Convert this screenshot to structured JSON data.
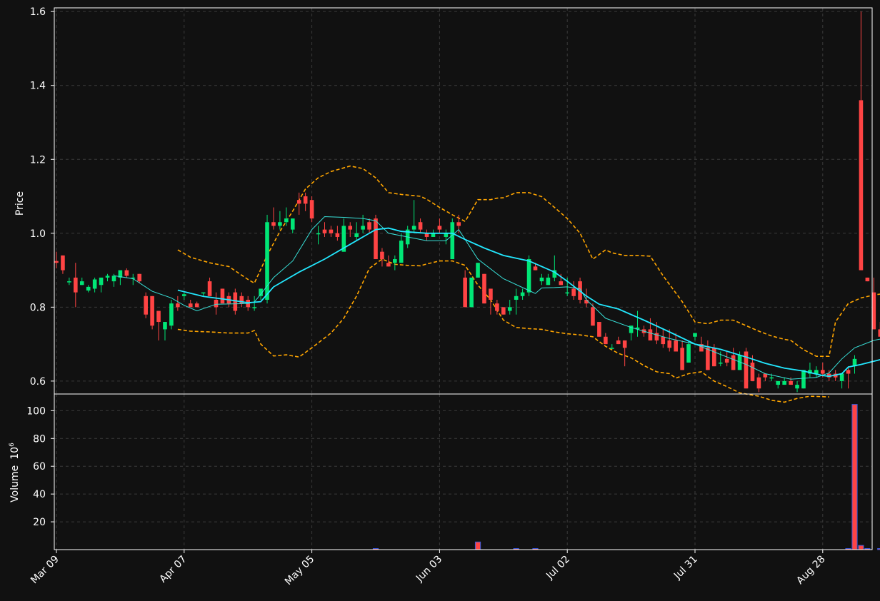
{
  "colors": {
    "background": "#111111",
    "up": "#00e676",
    "down": "#ff4444",
    "ma_fast": "#38e0d8",
    "ma_slow": "#22e8ff",
    "bollinger": "#ffa500",
    "grid": "#3a3a3a",
    "volume_edge": "#3b5bdb"
  },
  "chart_data": {
    "type": "candlestick",
    "title": "",
    "ylabel": "Price",
    "volume_ylabel": "Volume",
    "volume_unit_base": "10",
    "volume_unit_exp": "6",
    "grid": true,
    "price_ylim": [
      0.565,
      1.61
    ],
    "volume_ylim": [
      0,
      112
    ],
    "price_yticks": [
      "0.6",
      "0.8",
      "1.0",
      "1.2",
      "1.4",
      "1.6"
    ],
    "volume_yticks": [
      "20",
      "40",
      "60",
      "80",
      "100"
    ],
    "x_tick_labels": [
      {
        "index": 0,
        "label": "Mar 09"
      },
      {
        "index": 20,
        "label": "Apr 07"
      },
      {
        "index": 40,
        "label": "May 05"
      },
      {
        "index": 60,
        "label": "Jun 03"
      },
      {
        "index": 80,
        "label": "Jul 02"
      },
      {
        "index": 100,
        "label": "Jul 31"
      },
      {
        "index": 120,
        "label": "Aug 28"
      }
    ],
    "candles": [
      [
        0.925,
        0.95,
        0.905,
        0.92
      ],
      [
        0.94,
        0.94,
        0.89,
        0.9
      ],
      [
        0.87,
        0.88,
        0.86,
        0.87
      ],
      [
        0.88,
        0.92,
        0.8,
        0.84
      ],
      [
        0.86,
        0.88,
        0.86,
        0.87
      ],
      [
        0.845,
        0.86,
        0.84,
        0.855
      ],
      [
        0.85,
        0.88,
        0.84,
        0.875
      ],
      [
        0.86,
        0.88,
        0.84,
        0.88
      ],
      [
        0.88,
        0.89,
        0.87,
        0.885
      ],
      [
        0.87,
        0.89,
        0.855,
        0.885
      ],
      [
        0.88,
        0.89,
        0.86,
        0.9
      ],
      [
        0.9,
        0.905,
        0.88,
        0.885
      ],
      [
        0.88,
        0.89,
        0.86,
        0.88
      ],
      [
        0.89,
        0.89,
        0.865,
        0.87
      ],
      [
        0.83,
        0.84,
        0.77,
        0.78
      ],
      [
        0.83,
        0.83,
        0.74,
        0.75
      ],
      [
        0.79,
        0.79,
        0.71,
        0.76
      ],
      [
        0.74,
        0.76,
        0.71,
        0.76
      ],
      [
        0.75,
        0.82,
        0.74,
        0.81
      ],
      [
        0.81,
        0.83,
        0.79,
        0.8
      ],
      [
        0.83,
        0.84,
        0.82,
        0.835
      ],
      [
        0.81,
        0.82,
        0.8,
        0.8
      ],
      [
        0.81,
        0.815,
        0.8,
        0.8
      ],
      [
        0.84,
        0.84,
        0.83,
        0.84
      ],
      [
        0.87,
        0.88,
        0.83,
        0.83
      ],
      [
        0.82,
        0.84,
        0.78,
        0.8
      ],
      [
        0.85,
        0.85,
        0.82,
        0.81
      ],
      [
        0.83,
        0.84,
        0.8,
        0.81
      ],
      [
        0.84,
        0.85,
        0.78,
        0.79
      ],
      [
        0.83,
        0.84,
        0.8,
        0.81
      ],
      [
        0.82,
        0.83,
        0.79,
        0.8
      ],
      [
        0.8,
        0.83,
        0.79,
        0.8
      ],
      [
        0.83,
        0.85,
        0.82,
        0.85
      ],
      [
        0.82,
        1.05,
        0.81,
        1.03
      ],
      [
        1.03,
        1.07,
        1.01,
        1.02
      ],
      [
        1.02,
        1.06,
        1.01,
        1.03
      ],
      [
        1.03,
        1.07,
        1.02,
        1.04
      ],
      [
        1.01,
        1.04,
        1.0,
        1.04
      ],
      [
        1.09,
        1.11,
        1.05,
        1.08
      ],
      [
        1.1,
        1.11,
        1.06,
        1.08
      ],
      [
        1.09,
        1.1,
        1.03,
        1.04
      ],
      [
        1.0,
        1.02,
        0.97,
        1.0
      ],
      [
        1.01,
        1.03,
        0.99,
        1.0
      ],
      [
        1.01,
        1.02,
        0.99,
        1.0
      ],
      [
        1.0,
        1.02,
        0.98,
        0.99
      ],
      [
        0.95,
        1.04,
        0.95,
        1.02
      ],
      [
        1.02,
        1.03,
        0.99,
        1.01
      ],
      [
        0.99,
        1.03,
        0.98,
        1.0
      ],
      [
        1.01,
        1.05,
        1.0,
        1.02
      ],
      [
        1.03,
        1.04,
        1.0,
        1.01
      ],
      [
        1.04,
        1.05,
        0.93,
        0.93
      ],
      [
        0.95,
        0.96,
        0.91,
        0.93
      ],
      [
        0.92,
        0.94,
        0.91,
        0.91
      ],
      [
        0.92,
        0.94,
        0.9,
        0.93
      ],
      [
        0.92,
        1.0,
        0.92,
        0.98
      ],
      [
        0.97,
        1.02,
        0.96,
        1.01
      ],
      [
        1.01,
        1.09,
        1.0,
        1.02
      ],
      [
        1.03,
        1.04,
        1.0,
        1.01
      ],
      [
        1.0,
        1.01,
        0.98,
        0.99
      ],
      [
        0.99,
        1.01,
        0.99,
        1.0
      ],
      [
        1.02,
        1.04,
        1.0,
        1.01
      ],
      [
        0.99,
        1.01,
        0.97,
        1.0
      ],
      [
        0.93,
        1.04,
        0.93,
        1.03
      ],
      [
        1.03,
        1.05,
        1.0,
        1.02
      ],
      [
        0.88,
        0.9,
        0.8,
        0.8
      ],
      [
        0.8,
        0.88,
        0.8,
        0.88
      ],
      [
        0.88,
        0.92,
        0.88,
        0.92
      ],
      [
        0.89,
        0.89,
        0.81,
        0.81
      ],
      [
        0.85,
        0.85,
        0.78,
        0.82
      ],
      [
        0.81,
        0.82,
        0.78,
        0.79
      ],
      [
        0.8,
        0.8,
        0.78,
        0.78
      ],
      [
        0.79,
        0.82,
        0.78,
        0.8
      ],
      [
        0.82,
        0.85,
        0.78,
        0.83
      ],
      [
        0.83,
        0.85,
        0.82,
        0.84
      ],
      [
        0.84,
        0.94,
        0.83,
        0.93
      ],
      [
        0.91,
        0.92,
        0.9,
        0.9
      ],
      [
        0.87,
        0.89,
        0.86,
        0.88
      ],
      [
        0.86,
        0.89,
        0.86,
        0.88
      ],
      [
        0.88,
        0.94,
        0.87,
        0.9
      ],
      [
        0.87,
        0.89,
        0.86,
        0.86
      ],
      [
        0.84,
        0.88,
        0.83,
        0.84
      ],
      [
        0.85,
        0.87,
        0.82,
        0.83
      ],
      [
        0.87,
        0.88,
        0.81,
        0.82
      ],
      [
        0.82,
        0.85,
        0.8,
        0.81
      ],
      [
        0.8,
        0.81,
        0.75,
        0.75
      ],
      [
        0.76,
        0.76,
        0.72,
        0.72
      ],
      [
        0.72,
        0.73,
        0.7,
        0.7
      ],
      [
        0.69,
        0.7,
        0.69,
        0.69
      ],
      [
        0.71,
        0.72,
        0.7,
        0.7
      ],
      [
        0.71,
        0.71,
        0.64,
        0.69
      ],
      [
        0.73,
        0.75,
        0.71,
        0.75
      ],
      [
        0.74,
        0.79,
        0.72,
        0.745
      ],
      [
        0.74,
        0.75,
        0.72,
        0.73
      ],
      [
        0.74,
        0.77,
        0.71,
        0.71
      ],
      [
        0.73,
        0.76,
        0.7,
        0.71
      ],
      [
        0.72,
        0.74,
        0.69,
        0.7
      ],
      [
        0.71,
        0.74,
        0.68,
        0.69
      ],
      [
        0.71,
        0.73,
        0.69,
        0.68
      ],
      [
        0.69,
        0.71,
        0.63,
        0.63
      ],
      [
        0.65,
        0.71,
        0.65,
        0.7
      ],
      [
        0.72,
        0.73,
        0.71,
        0.73
      ],
      [
        0.7,
        0.72,
        0.68,
        0.68
      ],
      [
        0.69,
        0.71,
        0.63,
        0.63
      ],
      [
        0.69,
        0.7,
        0.64,
        0.64
      ],
      [
        0.65,
        0.68,
        0.64,
        0.65
      ],
      [
        0.66,
        0.68,
        0.64,
        0.65
      ],
      [
        0.67,
        0.69,
        0.63,
        0.63
      ],
      [
        0.63,
        0.68,
        0.63,
        0.67
      ],
      [
        0.68,
        0.69,
        0.58,
        0.58
      ],
      [
        0.65,
        0.67,
        0.6,
        0.6
      ],
      [
        0.61,
        0.62,
        0.57,
        0.58
      ],
      [
        0.62,
        0.62,
        0.6,
        0.61
      ],
      [
        0.61,
        0.62,
        0.6,
        0.61
      ],
      [
        0.59,
        0.6,
        0.58,
        0.6
      ],
      [
        0.59,
        0.61,
        0.59,
        0.6
      ],
      [
        0.6,
        0.61,
        0.59,
        0.59
      ],
      [
        0.58,
        0.6,
        0.57,
        0.59
      ],
      [
        0.58,
        0.63,
        0.58,
        0.63
      ],
      [
        0.62,
        0.65,
        0.61,
        0.63
      ],
      [
        0.62,
        0.64,
        0.61,
        0.63
      ],
      [
        0.63,
        0.65,
        0.61,
        0.62
      ],
      [
        0.62,
        0.63,
        0.6,
        0.61
      ],
      [
        0.62,
        0.63,
        0.6,
        0.61
      ],
      [
        0.6,
        0.62,
        0.58,
        0.62
      ],
      [
        0.63,
        0.64,
        0.58,
        0.62
      ],
      [
        0.64,
        0.67,
        0.62,
        0.66
      ],
      [
        1.36,
        1.6,
        0.9,
        0.9
      ],
      [
        0.88,
        0.88,
        0.87,
        0.87
      ],
      [
        0.84,
        0.88,
        0.74,
        0.74
      ],
      [
        0.74,
        0.76,
        0.72,
        0.72
      ],
      [
        0.74,
        0.76,
        0.72,
        0.72
      ],
      [
        0.73,
        0.74,
        0.65,
        0.65
      ],
      [
        0.65,
        0.7,
        0.65,
        0.69
      ]
    ],
    "volume_spikes": [
      {
        "index": 50,
        "value": 0.2
      },
      {
        "index": 66,
        "value": 5.5
      },
      {
        "index": 72,
        "value": 0.4
      },
      {
        "index": 75,
        "value": 0.2
      },
      {
        "index": 124,
        "value": 0.3
      },
      {
        "index": 125,
        "value": 104.5
      },
      {
        "index": 126,
        "value": 3.0
      },
      {
        "index": 127,
        "value": 0.7
      },
      {
        "index": 129,
        "value": 0.3
      }
    ],
    "moving_avg_fast": [
      [
        9,
        0.885
      ],
      [
        12,
        0.877
      ],
      [
        15,
        0.843
      ],
      [
        18,
        0.825
      ],
      [
        20,
        0.805
      ],
      [
        22,
        0.79
      ],
      [
        25,
        0.808
      ],
      [
        30,
        0.81
      ],
      [
        31,
        0.814
      ],
      [
        32,
        0.835
      ],
      [
        34,
        0.88
      ],
      [
        37,
        0.925
      ],
      [
        40,
        1.01
      ],
      [
        42,
        1.045
      ],
      [
        45,
        1.043
      ],
      [
        48,
        1.04
      ],
      [
        50,
        1.034
      ],
      [
        52,
        1.0
      ],
      [
        55,
        0.99
      ],
      [
        58,
        0.98
      ],
      [
        61,
        0.98
      ],
      [
        63,
        1.01
      ],
      [
        66,
        0.93
      ],
      [
        70,
        0.877
      ],
      [
        74,
        0.845
      ],
      [
        75,
        0.837
      ],
      [
        76,
        0.852
      ],
      [
        78,
        0.853
      ],
      [
        80,
        0.855
      ],
      [
        82,
        0.85
      ],
      [
        83,
        0.82
      ],
      [
        86,
        0.77
      ],
      [
        90,
        0.745
      ],
      [
        93,
        0.73
      ],
      [
        96,
        0.715
      ],
      [
        100,
        0.7
      ],
      [
        104,
        0.672
      ],
      [
        108,
        0.645
      ],
      [
        111,
        0.62
      ],
      [
        115,
        0.605
      ],
      [
        119,
        0.61
      ],
      [
        121,
        0.622
      ],
      [
        123,
        0.66
      ],
      [
        125,
        0.69
      ],
      [
        128,
        0.71
      ],
      [
        130,
        0.717
      ]
    ],
    "moving_avg_slow": [
      [
        19,
        0.846
      ],
      [
        23,
        0.829
      ],
      [
        27,
        0.82
      ],
      [
        30,
        0.812
      ],
      [
        32,
        0.815
      ],
      [
        34,
        0.855
      ],
      [
        38,
        0.895
      ],
      [
        42,
        0.93
      ],
      [
        46,
        0.97
      ],
      [
        50,
        1.01
      ],
      [
        52,
        1.014
      ],
      [
        54,
        1.005
      ],
      [
        58,
        1.0
      ],
      [
        62,
        1.0
      ],
      [
        64,
        0.983
      ],
      [
        67,
        0.96
      ],
      [
        70,
        0.94
      ],
      [
        74,
        0.925
      ],
      [
        78,
        0.895
      ],
      [
        80,
        0.87
      ],
      [
        83,
        0.83
      ],
      [
        85,
        0.808
      ],
      [
        88,
        0.795
      ],
      [
        92,
        0.765
      ],
      [
        96,
        0.733
      ],
      [
        100,
        0.7
      ],
      [
        104,
        0.686
      ],
      [
        108,
        0.665
      ],
      [
        111,
        0.648
      ],
      [
        114,
        0.635
      ],
      [
        117,
        0.627
      ],
      [
        120,
        0.615
      ],
      [
        121,
        0.613
      ],
      [
        123,
        0.62
      ],
      [
        124,
        0.638
      ],
      [
        126,
        0.645
      ],
      [
        129,
        0.658
      ],
      [
        130,
        0.66
      ]
    ],
    "bollinger_upper": [
      [
        19,
        0.955
      ],
      [
        21,
        0.935
      ],
      [
        24,
        0.92
      ],
      [
        27,
        0.91
      ],
      [
        30,
        0.875
      ],
      [
        31,
        0.865
      ],
      [
        33,
        0.94
      ],
      [
        35,
        1.005
      ],
      [
        37,
        1.06
      ],
      [
        39,
        1.12
      ],
      [
        41,
        1.15
      ],
      [
        43,
        1.167
      ],
      [
        45,
        1.177
      ],
      [
        46,
        1.182
      ],
      [
        48,
        1.175
      ],
      [
        50,
        1.15
      ],
      [
        52,
        1.11
      ],
      [
        54,
        1.105
      ],
      [
        57,
        1.1
      ],
      [
        58,
        1.092
      ],
      [
        60,
        1.07
      ],
      [
        62,
        1.05
      ],
      [
        64,
        1.032
      ],
      [
        66,
        1.091
      ],
      [
        68,
        1.091
      ],
      [
        69,
        1.095
      ],
      [
        70,
        1.096
      ],
      [
        72,
        1.11
      ],
      [
        74,
        1.11
      ],
      [
        76,
        1.099
      ],
      [
        78,
        1.07
      ],
      [
        80,
        1.04
      ],
      [
        82,
        1.0
      ],
      [
        84,
        0.93
      ],
      [
        86,
        0.955
      ],
      [
        87,
        0.947
      ],
      [
        89,
        0.94
      ],
      [
        91,
        0.94
      ],
      [
        93,
        0.938
      ],
      [
        95,
        0.885
      ],
      [
        98,
        0.815
      ],
      [
        100,
        0.76
      ],
      [
        102,
        0.755
      ],
      [
        104,
        0.765
      ],
      [
        106,
        0.765
      ],
      [
        108,
        0.75
      ],
      [
        110,
        0.735
      ],
      [
        112,
        0.722
      ],
      [
        114,
        0.713
      ],
      [
        115,
        0.71
      ],
      [
        117,
        0.685
      ],
      [
        119,
        0.667
      ],
      [
        121,
        0.667
      ],
      [
        122,
        0.76
      ],
      [
        124,
        0.81
      ],
      [
        126,
        0.825
      ],
      [
        128,
        0.833
      ],
      [
        130,
        0.838
      ]
    ],
    "bollinger_lower": [
      [
        19,
        0.74
      ],
      [
        21,
        0.735
      ],
      [
        24,
        0.733
      ],
      [
        27,
        0.73
      ],
      [
        30,
        0.73
      ],
      [
        31,
        0.737
      ],
      [
        32,
        0.7
      ],
      [
        34,
        0.668
      ],
      [
        36,
        0.671
      ],
      [
        38,
        0.665
      ],
      [
        40,
        0.69
      ],
      [
        43,
        0.73
      ],
      [
        45,
        0.77
      ],
      [
        47,
        0.83
      ],
      [
        49,
        0.905
      ],
      [
        51,
        0.93
      ],
      [
        53,
        0.916
      ],
      [
        55,
        0.913
      ],
      [
        57,
        0.912
      ],
      [
        58,
        0.917
      ],
      [
        60,
        0.925
      ],
      [
        62,
        0.925
      ],
      [
        64,
        0.913
      ],
      [
        66,
        0.86
      ],
      [
        68,
        0.82
      ],
      [
        70,
        0.765
      ],
      [
        72,
        0.745
      ],
      [
        74,
        0.742
      ],
      [
        76,
        0.74
      ],
      [
        78,
        0.733
      ],
      [
        80,
        0.728
      ],
      [
        82,
        0.725
      ],
      [
        84,
        0.72
      ],
      [
        86,
        0.694
      ],
      [
        88,
        0.675
      ],
      [
        90,
        0.663
      ],
      [
        92,
        0.642
      ],
      [
        94,
        0.625
      ],
      [
        96,
        0.62
      ],
      [
        97,
        0.608
      ],
      [
        99,
        0.62
      ],
      [
        101,
        0.625
      ],
      [
        103,
        0.6
      ],
      [
        105,
        0.585
      ],
      [
        107,
        0.568
      ],
      [
        110,
        0.559
      ],
      [
        112,
        0.548
      ],
      [
        114,
        0.543
      ],
      [
        116,
        0.553
      ],
      [
        118,
        0.559
      ],
      [
        121,
        0.557
      ]
    ]
  }
}
